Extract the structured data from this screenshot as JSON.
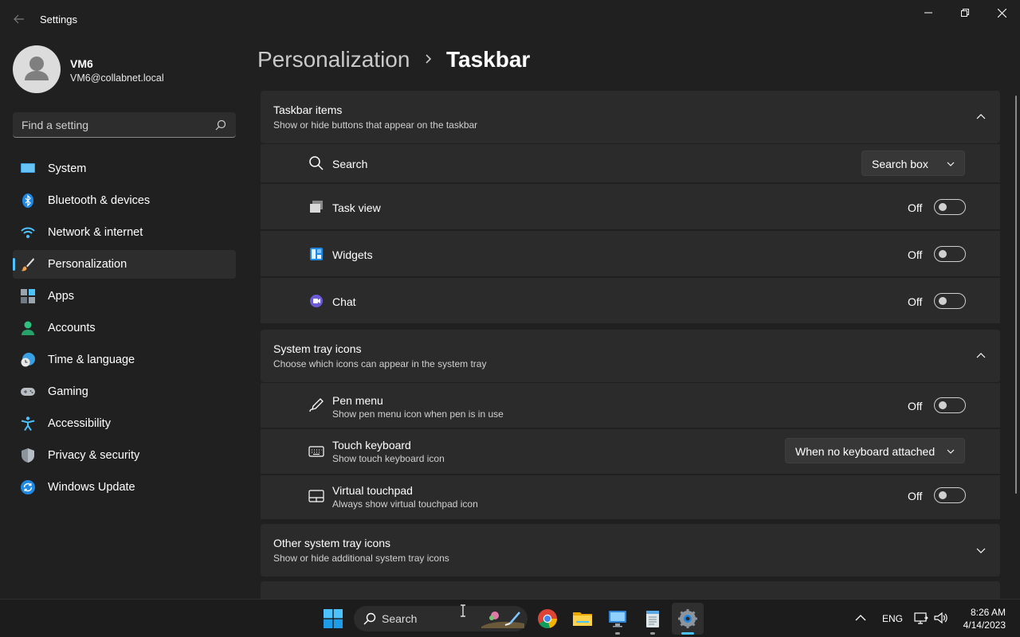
{
  "window": {
    "title": "Settings"
  },
  "user": {
    "name": "VM6",
    "email": "VM6@collabnet.local"
  },
  "search": {
    "placeholder": "Find a setting"
  },
  "sidebar": {
    "items": [
      {
        "label": "System",
        "icon": "monitor-icon",
        "active": false
      },
      {
        "label": "Bluetooth & devices",
        "icon": "bluetooth-icon",
        "active": false
      },
      {
        "label": "Network & internet",
        "icon": "wifi-icon",
        "active": false
      },
      {
        "label": "Personalization",
        "icon": "brush-icon",
        "active": true
      },
      {
        "label": "Apps",
        "icon": "apps-icon",
        "active": false
      },
      {
        "label": "Accounts",
        "icon": "person-icon",
        "active": false
      },
      {
        "label": "Time & language",
        "icon": "globe-clock-icon",
        "active": false
      },
      {
        "label": "Gaming",
        "icon": "gamepad-icon",
        "active": false
      },
      {
        "label": "Accessibility",
        "icon": "accessibility-icon",
        "active": false
      },
      {
        "label": "Privacy & security",
        "icon": "shield-icon",
        "active": false
      },
      {
        "label": "Windows Update",
        "icon": "update-icon",
        "active": false
      }
    ]
  },
  "breadcrumb": {
    "parent": "Personalization",
    "current": "Taskbar"
  },
  "sections": {
    "taskbar_items": {
      "title": "Taskbar items",
      "subtitle": "Show or hide buttons that appear on the taskbar",
      "rows": [
        {
          "label": "Search",
          "control": "dropdown",
          "value": "Search box",
          "icon": "search-icon"
        },
        {
          "label": "Task view",
          "control": "toggle",
          "value": "Off",
          "icon": "task-view-icon"
        },
        {
          "label": "Widgets",
          "control": "toggle",
          "value": "Off",
          "icon": "widgets-icon"
        },
        {
          "label": "Chat",
          "control": "toggle",
          "value": "Off",
          "icon": "chat-icon"
        }
      ]
    },
    "system_tray": {
      "title": "System tray icons",
      "subtitle": "Choose which icons can appear in the system tray",
      "rows": [
        {
          "label": "Pen menu",
          "sub": "Show pen menu icon when pen is in use",
          "control": "toggle",
          "value": "Off",
          "icon": "pen-icon"
        },
        {
          "label": "Touch keyboard",
          "sub": "Show touch keyboard icon",
          "control": "dropdown",
          "value": "When no keyboard attached",
          "icon": "keyboard-icon"
        },
        {
          "label": "Virtual touchpad",
          "sub": "Always show virtual touchpad icon",
          "control": "toggle",
          "value": "Off",
          "icon": "touchpad-icon"
        }
      ]
    },
    "other_tray": {
      "title": "Other system tray icons",
      "subtitle": "Show or hide additional system tray icons"
    }
  },
  "taskbar": {
    "search_label": "Search",
    "language": "ENG",
    "time": "8:26 AM",
    "date": "4/14/2023",
    "apps": [
      "chrome-icon",
      "file-explorer-icon",
      "remote-desktop-icon",
      "notepad-icon",
      "settings-icon"
    ]
  },
  "colors": {
    "accent": "#4cc2ff",
    "background": "#202020",
    "card": "#2b2b2b"
  }
}
